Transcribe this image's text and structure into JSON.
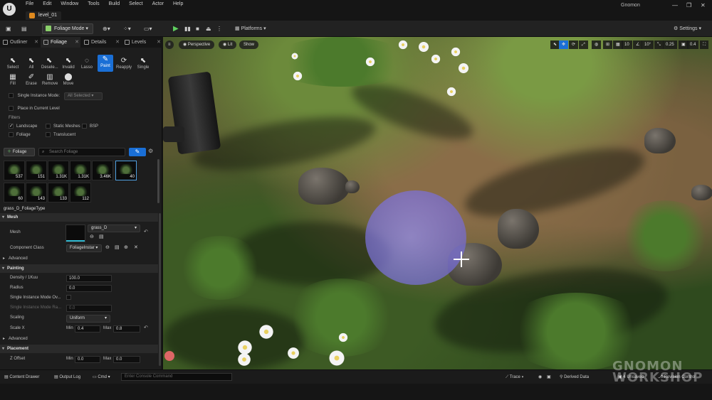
{
  "app": {
    "logo": "U",
    "level_tab": "level_01",
    "menu": [
      "File",
      "Edit",
      "Window",
      "Tools",
      "Build",
      "Select",
      "Actor",
      "Help"
    ],
    "user": "Gnomon",
    "window_controls": [
      "—",
      "❐",
      "✕"
    ]
  },
  "toolbar": {
    "mode": "Foliage Mode",
    "platforms": "Platforms",
    "settings": "Settings"
  },
  "tabs": [
    {
      "label": "Outliner"
    },
    {
      "label": "Foliage"
    },
    {
      "label": "Details"
    },
    {
      "label": "Levels"
    }
  ],
  "tools_row1": [
    {
      "label": "Select",
      "icon": "⬉"
    },
    {
      "label": "All",
      "icon": "⬉"
    },
    {
      "label": "Desele...",
      "icon": "⬉"
    },
    {
      "label": "Invalid",
      "icon": "⬉"
    },
    {
      "label": "Lasso",
      "icon": "◌"
    },
    {
      "label": "Paint",
      "icon": "✎"
    },
    {
      "label": "Reapply",
      "icon": "⟳"
    },
    {
      "label": "Single",
      "icon": "⬉"
    }
  ],
  "tools_row2": [
    {
      "label": "Fill",
      "icon": "▦"
    },
    {
      "label": "Erase",
      "icon": "✐"
    },
    {
      "label": "Remove",
      "icon": "▥"
    },
    {
      "label": "Move",
      "icon": "⬤"
    }
  ],
  "options": {
    "single_instance_mode": "Single Instance Mode:",
    "single_instance_value": "All Selected",
    "place_in_current_level": "Place in Current Level",
    "filters_label": "Filters",
    "filters": [
      "Landscape",
      "Static Meshes",
      "BSP",
      "Foliage",
      "Translucent"
    ]
  },
  "foliage": {
    "add_label": "Foliage",
    "search_placeholder": "Search Foliage",
    "counts": [
      "537",
      "151",
      "1.31K",
      "1.31K",
      "3.46K",
      "40",
      "60",
      "143",
      "133",
      "112"
    ],
    "selected_type": "grass_D_FoliageType"
  },
  "details": {
    "mesh_section": "Mesh",
    "mesh_label": "Mesh",
    "mesh_value": "grass_D",
    "component_class_label": "Component Class",
    "component_class_value": "FoliageInstar",
    "advanced": "Advanced",
    "painting_section": "Painting",
    "density_label": "Density / 1Kuu",
    "density_value": "100.0",
    "radius_label": "Radius",
    "radius_value": "0.0",
    "single_instance_override": "Single Instance Mode Ov...",
    "single_instance_radius": "Single Instance Mode Ra...",
    "single_instance_radius_value": "0.0",
    "scaling_label": "Scaling",
    "scaling_value": "Uniform",
    "scale_x_label": "Scale X",
    "min_label": "Min",
    "max_label": "Max",
    "scale_x_min": "0.4",
    "scale_x_max": "0.8",
    "advanced2": "Advanced",
    "placement_section": "Placement",
    "z_offset_label": "Z Offset",
    "z_offset_min": "0.0",
    "z_offset_max": "0.0"
  },
  "viewport": {
    "perspective": "Perspective",
    "lit": "Lit",
    "show": "Show",
    "grid_value": "10",
    "angle_value": "10°",
    "scale_value": "0.25",
    "camera_value": "0.4"
  },
  "statusbar": {
    "content_drawer": "Content Drawer",
    "output_log": "Output Log",
    "cmd": "Cmd",
    "console_placeholder": "Enter Console Command",
    "trace": "Trace",
    "derived_data": "Derived Data",
    "unsaved": "4 Unsaved",
    "revision_control": "Revision Control"
  },
  "watermark": {
    "line1": "GNOMON",
    "line2": "WORKSHOP"
  },
  "colors": {
    "accent": "#1a6fd6",
    "brush": "#8f86e0",
    "panel": "#1d1d1d"
  }
}
